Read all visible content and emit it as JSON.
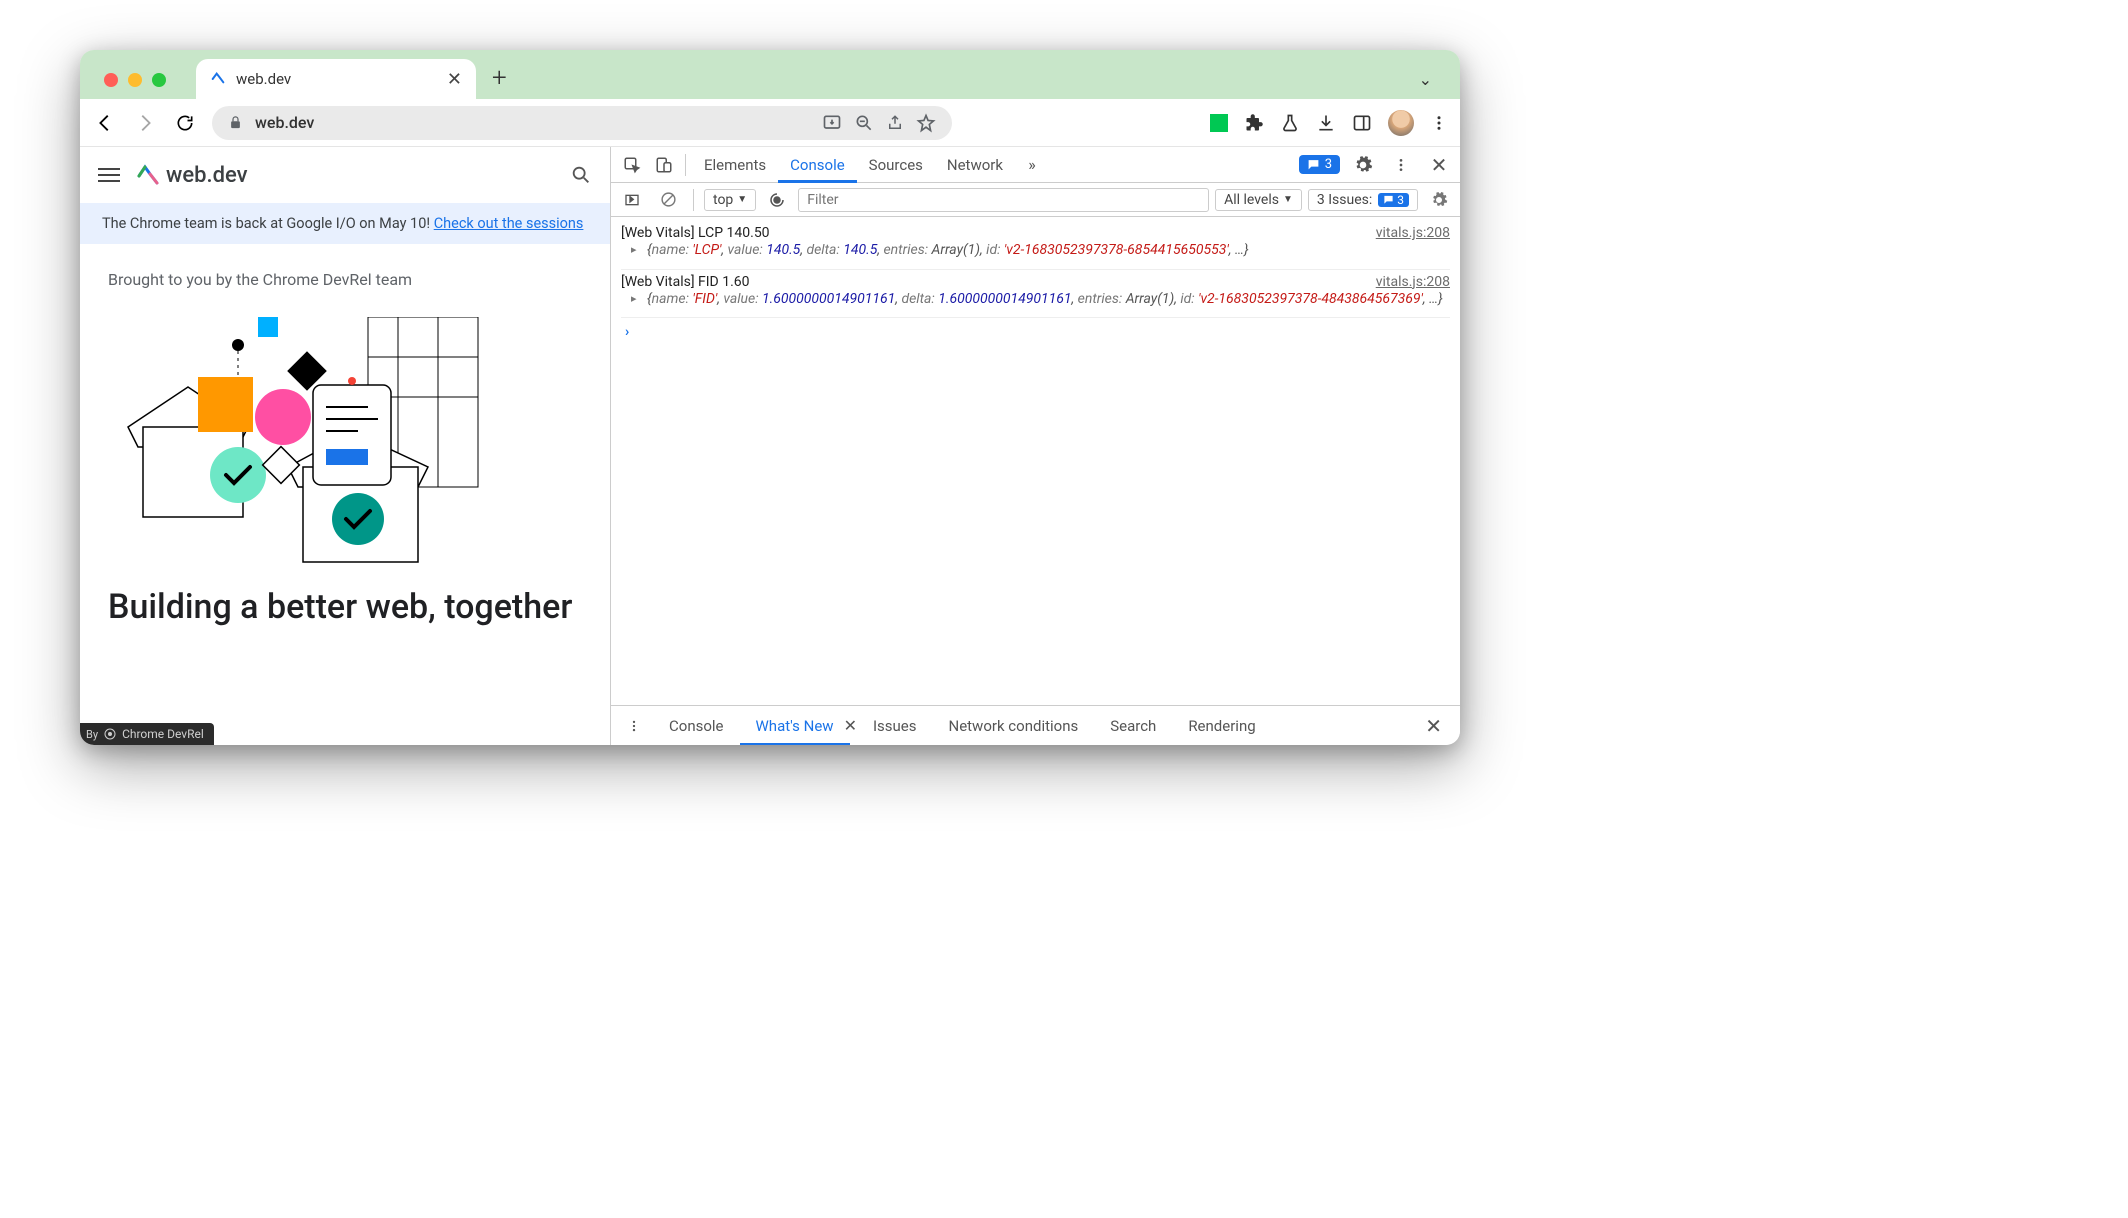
{
  "chrome": {
    "tab_title": "web.dev",
    "omnibox_text": "web.dev",
    "messages_count": "3"
  },
  "page": {
    "site_name": "web.dev",
    "banner_text": "The Chrome team is back at Google I/O on May 10! ",
    "banner_link": "Check out the sessions",
    "subhead": "Brought to you by the Chrome DevRel team",
    "hero": "Building a better web, together",
    "badge": "Chrome DevRel"
  },
  "devtools": {
    "tabs": [
      "Elements",
      "Console",
      "Sources",
      "Network"
    ],
    "active_tab": "Console",
    "context": "top",
    "filter_placeholder": "Filter",
    "levels_label": "All levels",
    "issues_label": "3 Issues:",
    "issues_count": "3",
    "console_entries": [
      {
        "header": "[Web Vitals] LCP 140.50",
        "source": "vitals.js:208",
        "object_parts": [
          {
            "t": "{",
            "c": ""
          },
          {
            "t": "name: ",
            "c": "s-key"
          },
          {
            "t": "'LCP'",
            "c": "s-str"
          },
          {
            "t": ", ",
            "c": ""
          },
          {
            "t": "value: ",
            "c": "s-key"
          },
          {
            "t": "140.5",
            "c": "s-num"
          },
          {
            "t": ", ",
            "c": ""
          },
          {
            "t": "delta: ",
            "c": "s-key"
          },
          {
            "t": "140.5",
            "c": "s-num"
          },
          {
            "t": ", ",
            "c": ""
          },
          {
            "t": "entries: ",
            "c": "s-key"
          },
          {
            "t": "Array(1)",
            "c": ""
          },
          {
            "t": ", ",
            "c": ""
          },
          {
            "t": "id: ",
            "c": "s-key"
          },
          {
            "t": "'v2-1683052397378-6854415650553'",
            "c": "s-str"
          },
          {
            "t": ", …}",
            "c": ""
          }
        ]
      },
      {
        "header": "[Web Vitals] FID 1.60",
        "source": "vitals.js:208",
        "object_parts": [
          {
            "t": "{",
            "c": ""
          },
          {
            "t": "name: ",
            "c": "s-key"
          },
          {
            "t": "'FID'",
            "c": "s-str"
          },
          {
            "t": ", ",
            "c": ""
          },
          {
            "t": "value: ",
            "c": "s-key"
          },
          {
            "t": "1.6000000014901161",
            "c": "s-num"
          },
          {
            "t": ", ",
            "c": ""
          },
          {
            "t": "delta: ",
            "c": "s-key"
          },
          {
            "t": "1.6000000014901161",
            "c": "s-num"
          },
          {
            "t": ", ",
            "c": ""
          },
          {
            "t": "entries: ",
            "c": "s-key"
          },
          {
            "t": "Array(1)",
            "c": ""
          },
          {
            "t": ", ",
            "c": ""
          },
          {
            "t": "id: ",
            "c": "s-key"
          },
          {
            "t": "'v2-1683052397378-4843864567369'",
            "c": "s-str"
          },
          {
            "t": ", …}",
            "c": ""
          }
        ]
      }
    ],
    "drawer_tabs": [
      "Console",
      "What's New",
      "Issues",
      "Network conditions",
      "Search",
      "Rendering"
    ],
    "drawer_active": "What's New"
  }
}
